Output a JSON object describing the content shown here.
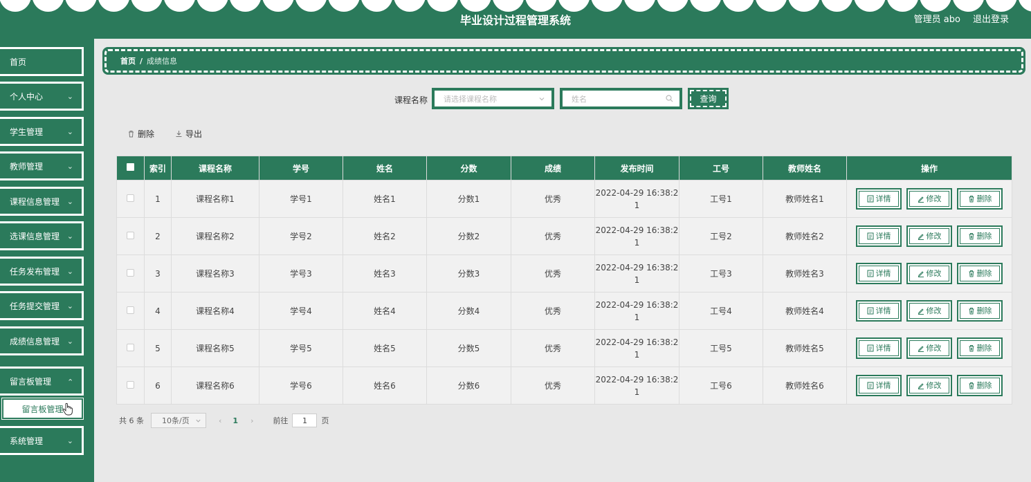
{
  "header": {
    "title": "毕业设计过程管理系统",
    "user": "管理员 abo",
    "logout": "退出登录"
  },
  "sidebar": {
    "items": [
      {
        "label": "首页",
        "has_arrow": false
      },
      {
        "label": "个人中心",
        "has_arrow": true
      },
      {
        "label": "学生管理",
        "has_arrow": true
      },
      {
        "label": "教师管理",
        "has_arrow": true
      },
      {
        "label": "课程信息管理",
        "has_arrow": true
      },
      {
        "label": "选课信息管理",
        "has_arrow": true
      },
      {
        "label": "任务发布管理",
        "has_arrow": true
      },
      {
        "label": "任务提交管理",
        "has_arrow": true
      },
      {
        "label": "成绩信息管理",
        "has_arrow": true
      },
      {
        "label": "留言板管理",
        "has_arrow": true,
        "expanded": true
      },
      {
        "label": "系统管理",
        "has_arrow": true
      }
    ],
    "sub_item": "留言板管理"
  },
  "breadcrumb": {
    "home": "首页",
    "separator": "/",
    "current": "成绩信息"
  },
  "search": {
    "label": "课程名称",
    "select_placeholder": "请选择课程名称",
    "name_placeholder": "姓名",
    "query_button": "查询"
  },
  "toolbar": {
    "delete": "删除",
    "export": "导出"
  },
  "table": {
    "columns": [
      "索引",
      "课程名称",
      "学号",
      "姓名",
      "分数",
      "成绩",
      "发布时间",
      "工号",
      "教师姓名",
      "操作"
    ],
    "rows": [
      {
        "index": "1",
        "course": "课程名称1",
        "student_no": "学号1",
        "name": "姓名1",
        "score": "分数1",
        "grade": "优秀",
        "time_a": "2022-04-29 16:38:2",
        "time_b": "1",
        "emp_no": "工号1",
        "teacher": "教师姓名1"
      },
      {
        "index": "2",
        "course": "课程名称2",
        "student_no": "学号2",
        "name": "姓名2",
        "score": "分数2",
        "grade": "优秀",
        "time_a": "2022-04-29 16:38:2",
        "time_b": "1",
        "emp_no": "工号2",
        "teacher": "教师姓名2"
      },
      {
        "index": "3",
        "course": "课程名称3",
        "student_no": "学号3",
        "name": "姓名3",
        "score": "分数3",
        "grade": "优秀",
        "time_a": "2022-04-29 16:38:2",
        "time_b": "1",
        "emp_no": "工号3",
        "teacher": "教师姓名3"
      },
      {
        "index": "4",
        "course": "课程名称4",
        "student_no": "学号4",
        "name": "姓名4",
        "score": "分数4",
        "grade": "优秀",
        "time_a": "2022-04-29 16:38:2",
        "time_b": "1",
        "emp_no": "工号4",
        "teacher": "教师姓名4"
      },
      {
        "index": "5",
        "course": "课程名称5",
        "student_no": "学号5",
        "name": "姓名5",
        "score": "分数5",
        "grade": "优秀",
        "time_a": "2022-04-29 16:38:2",
        "time_b": "1",
        "emp_no": "工号5",
        "teacher": "教师姓名5"
      },
      {
        "index": "6",
        "course": "课程名称6",
        "student_no": "学号6",
        "name": "姓名6",
        "score": "分数6",
        "grade": "优秀",
        "time_a": "2022-04-29 16:38:2",
        "time_b": "1",
        "emp_no": "工号6",
        "teacher": "教师姓名6"
      }
    ],
    "actions": {
      "detail": "详情",
      "edit": "修改",
      "delete": "删除"
    }
  },
  "pagination": {
    "total": "共 6 条",
    "page_size": "10条/页",
    "current_page": "1",
    "goto_label": "前往",
    "goto_value": "1",
    "unit": "页"
  },
  "colors": {
    "primary": "#2b7a5b",
    "background": "#e8e8e8"
  }
}
